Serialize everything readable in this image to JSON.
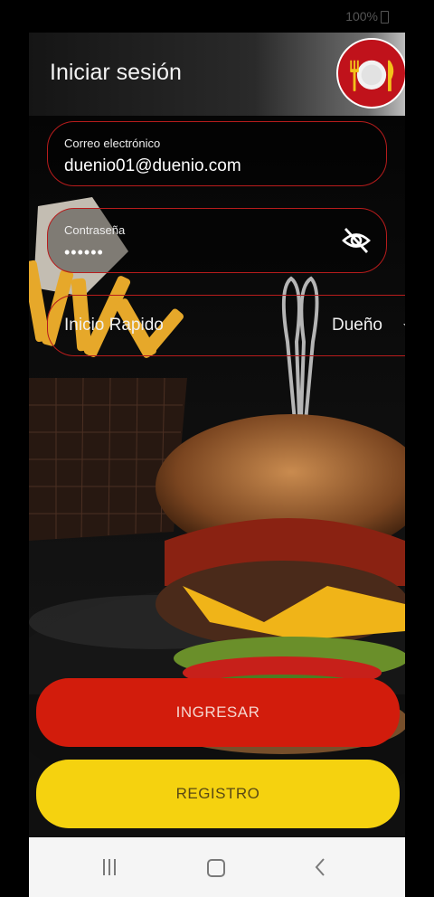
{
  "status": {
    "battery_text": "100%"
  },
  "header": {
    "title": "Iniciar sesión"
  },
  "logo": {
    "icon": "plate-fork-knife-icon",
    "bg": "#c0121b"
  },
  "form": {
    "email": {
      "label": "Correo electrónico",
      "value": "duenio01@duenio.com"
    },
    "password": {
      "label": "Contraseña",
      "value": "••••••",
      "toggle_icon": "eye-off-icon"
    },
    "quick_login": {
      "label": "Inicio Rapido",
      "selected": "Dueño"
    }
  },
  "buttons": {
    "login": {
      "label": "INGRESAR",
      "color": "#d21c0c"
    },
    "register": {
      "label": "REGISTRO",
      "color": "#f5d20f"
    }
  },
  "navbar": {
    "icons": [
      "recent-apps-icon",
      "home-icon",
      "back-icon"
    ]
  },
  "theme": {
    "field_border": "#b71c1c"
  }
}
